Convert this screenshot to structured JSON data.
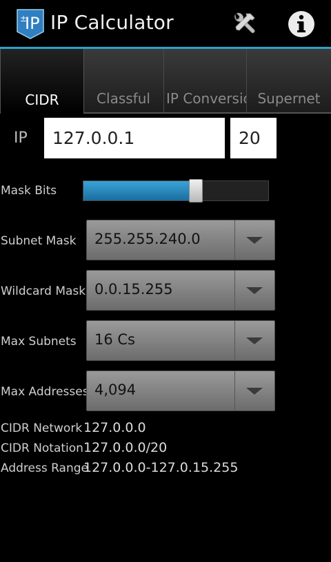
{
  "app": {
    "title": "IP Calculator",
    "icon_text": "IP",
    "icon_glyph": "±",
    "accent": "#2aa3c9"
  },
  "tabs": [
    {
      "label": "CIDR",
      "active": true
    },
    {
      "label": "Classful",
      "active": false
    },
    {
      "label": "IP  Conversion",
      "active": false
    },
    {
      "label": "Supernet",
      "active": false
    }
  ],
  "form": {
    "ip_label": "IP",
    "ip_value": "127.0.0.1",
    "mask_bits_value": "20",
    "mask_bits_label": "Mask Bits",
    "slider_fraction": 0.61,
    "subnet_mask_label": "Subnet Mask",
    "subnet_mask_value": "255.255.240.0",
    "wildcard_mask_label": "Wildcard Mask",
    "wildcard_mask_value": "0.0.15.255",
    "max_subnets_label": "Max Subnets",
    "max_subnets_value": "16 Cs",
    "max_addresses_label": "Max Addresses",
    "max_addresses_value": "4,094"
  },
  "results": {
    "cidr_network_label": "CIDR Network",
    "cidr_network_value": "127.0.0.0",
    "cidr_notation_label": "CIDR Notation",
    "cidr_notation_value": "127.0.0.0/20",
    "address_range_label": "Address Range",
    "address_range_value": "127.0.0.0-127.0.15.255"
  },
  "icons": {
    "settings": "tools-icon",
    "info": "info-icon"
  }
}
